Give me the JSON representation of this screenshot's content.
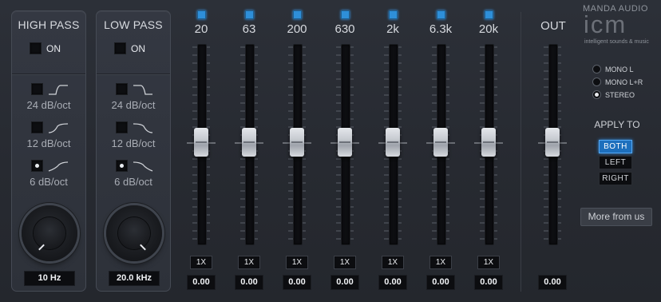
{
  "high_pass": {
    "title": "HIGH PASS",
    "on_label": "ON",
    "slopes": [
      {
        "label": "24 dB/oct",
        "selected": false
      },
      {
        "label": "12 dB/oct",
        "selected": false
      },
      {
        "label": "6 dB/oct",
        "selected": true
      }
    ],
    "frequency": "10 Hz"
  },
  "low_pass": {
    "title": "LOW PASS",
    "on_label": "ON",
    "slopes": [
      {
        "label": "24 dB/oct",
        "selected": false
      },
      {
        "label": "12 dB/oct",
        "selected": false
      },
      {
        "label": "6 dB/oct",
        "selected": true
      }
    ],
    "frequency": "20.0 kHz"
  },
  "bands": [
    {
      "freq": "20",
      "multiplier": "1X",
      "gain": "0.00"
    },
    {
      "freq": "63",
      "multiplier": "1X",
      "gain": "0.00"
    },
    {
      "freq": "200",
      "multiplier": "1X",
      "gain": "0.00"
    },
    {
      "freq": "630",
      "multiplier": "1X",
      "gain": "0.00"
    },
    {
      "freq": "2k",
      "multiplier": "1X",
      "gain": "0.00"
    },
    {
      "freq": "6.3k",
      "multiplier": "1X",
      "gain": "0.00"
    },
    {
      "freq": "20k",
      "multiplier": "1X",
      "gain": "0.00"
    }
  ],
  "output": {
    "label": "OUT",
    "gain": "0.00"
  },
  "logo": {
    "brand": "MANDA AUDIO",
    "name": "icm",
    "tagline": "intelligent sounds & music"
  },
  "channel_modes": [
    {
      "label": "MONO L",
      "selected": false
    },
    {
      "label": "MONO L+R",
      "selected": false
    },
    {
      "label": "STEREO",
      "selected": true
    }
  ],
  "apply_to": {
    "label": "APPLY TO",
    "options": [
      {
        "label": "BOTH",
        "active": true
      },
      {
        "label": "LEFT",
        "active": false
      },
      {
        "label": "RIGHT",
        "active": false
      }
    ]
  },
  "more_button": "More from us",
  "colors": {
    "led": "#2e8fd9",
    "active_button": "#1d6fbd"
  }
}
